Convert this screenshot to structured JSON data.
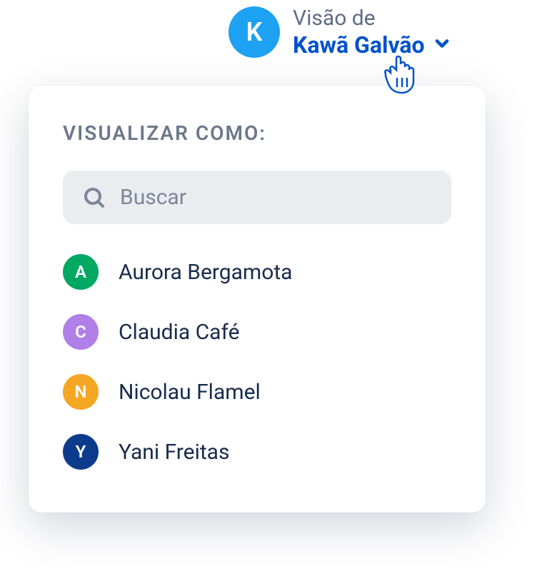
{
  "header": {
    "avatar_initial": "K",
    "label": "Visão de",
    "name": "Kawã Galvão"
  },
  "panel": {
    "title": "VISUALIZAR COMO:",
    "search_placeholder": "Buscar"
  },
  "users": [
    {
      "initial": "A",
      "name": "Aurora Bergamota",
      "color": "#00A862"
    },
    {
      "initial": "C",
      "name": "Claudia Café",
      "color": "#B07FE8"
    },
    {
      "initial": "N",
      "name": "Nicolau Flamel",
      "color": "#F5A623"
    },
    {
      "initial": "Y",
      "name": "Yani Freitas",
      "color": "#0D3B8C"
    }
  ]
}
